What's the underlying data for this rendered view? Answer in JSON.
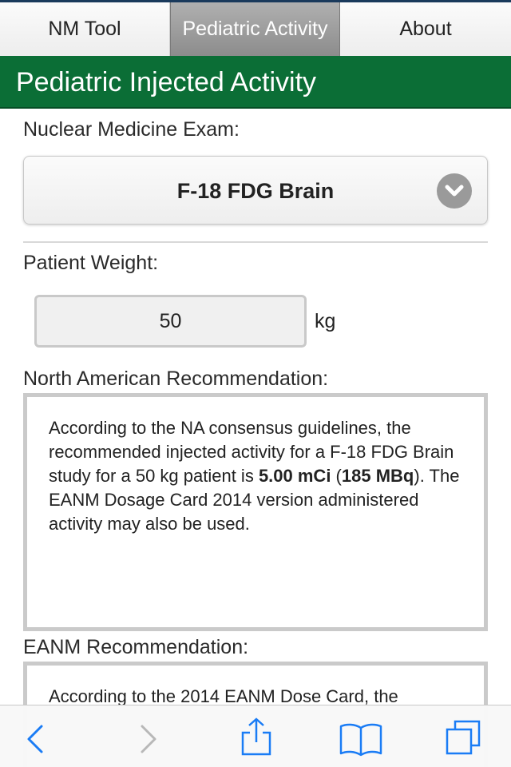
{
  "tabs": [
    {
      "label": "NM Tool"
    },
    {
      "label": "Pediatric Activity"
    },
    {
      "label": "About"
    }
  ],
  "header": {
    "title": "Pediatric Injected Activity"
  },
  "exam": {
    "label": "Nuclear Medicine Exam:",
    "selected": "F-18 FDG Brain"
  },
  "weight": {
    "label": "Patient Weight:",
    "value": "50",
    "unit": "kg"
  },
  "na": {
    "label": "North American Recommendation:",
    "text_a": "According to the NA consensus guidelines, the recommended injected activity for a F-18 FDG Brain study for a 50 kg patient is ",
    "mci": "5.00 mCi",
    "text_b": " (",
    "mbq": "185 MBq",
    "text_c": "). The EANM Dosage Card 2014 version administered activity may also be used."
  },
  "eanm": {
    "label": "EANM Recommendation:",
    "text": "According to the 2014 EANM Dose Card, the"
  },
  "toolbar": {
    "icons": [
      "back-icon",
      "forward-icon",
      "share-icon",
      "bookmarks-icon",
      "tabs-icon"
    ],
    "accent": "#1a7cf5"
  },
  "colors": {
    "header_bg": "#0b6e36",
    "active_tab": "#9a9a9a"
  }
}
